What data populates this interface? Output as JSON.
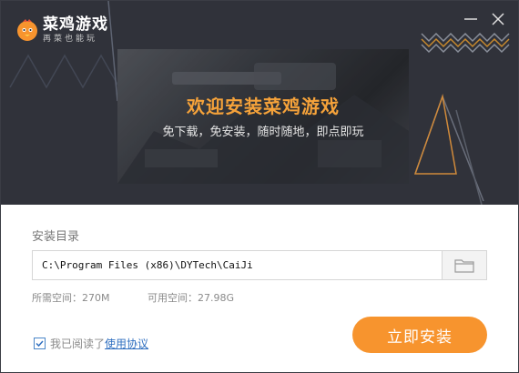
{
  "app": {
    "name": "菜鸡游戏",
    "slogan": "再菜也能玩"
  },
  "window_controls": {
    "minimize_icon": "minimize-icon",
    "close_icon": "close-icon"
  },
  "hero": {
    "title": "欢迎安装菜鸡游戏",
    "subtitle": "免下载，免安装，随时随地，即点即玩"
  },
  "install": {
    "dir_label": "安装目录",
    "path_value": "C:\\Program Files (x86)\\DYTech\\CaiJi",
    "browse_icon": "folder-icon",
    "space_required": "所需空间：270M",
    "space_available": "可用空间：27.98G",
    "agree_checked": true,
    "agree_text": "我已阅读了",
    "agree_link": "使用协议",
    "install_button": "立即安装"
  },
  "colors": {
    "banner_bg": "#30323a",
    "accent_orange": "#f7942e",
    "title_orange": "#f5a23a",
    "link_blue": "#2f6fc0"
  }
}
